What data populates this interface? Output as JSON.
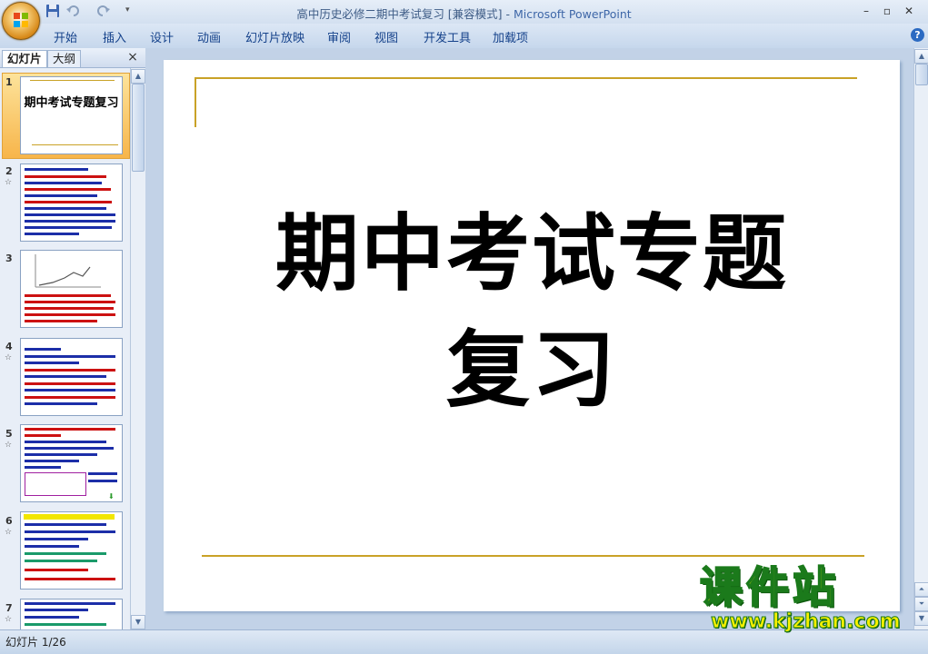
{
  "window": {
    "title_doc": "高中历史必修二期中考试复习 [兼容模式] - ",
    "title_app": "Microsoft PowerPoint"
  },
  "ribbon": {
    "tabs": [
      "开始",
      "插入",
      "设计",
      "动画",
      "幻灯片放映",
      "审阅",
      "视图",
      "开发工具",
      "加载项"
    ]
  },
  "panel": {
    "tab_slides": "幻灯片",
    "tab_outline": "大纲",
    "close": "×"
  },
  "thumbnails": [
    {
      "num": "1",
      "title": "期中考试专题复习",
      "transition": false,
      "selected": true
    },
    {
      "num": "2",
      "transition": true
    },
    {
      "num": "3",
      "transition": false
    },
    {
      "num": "4",
      "transition": true
    },
    {
      "num": "5",
      "transition": true
    },
    {
      "num": "6",
      "transition": true
    },
    {
      "num": "7",
      "transition": true
    }
  ],
  "slide": {
    "title": "期中考试专题复习",
    "accent_color": "#c9a227"
  },
  "status": {
    "slide_indicator": "幻灯片 1/26"
  },
  "watermark": {
    "brand": "课件站",
    "url": "www.kjzhan.com"
  },
  "icons": {
    "office": "office-logo-icon",
    "save": "save-icon",
    "undo": "undo-icon",
    "redo": "redo-icon",
    "help": "help-icon",
    "transition": "transition-star-icon"
  }
}
